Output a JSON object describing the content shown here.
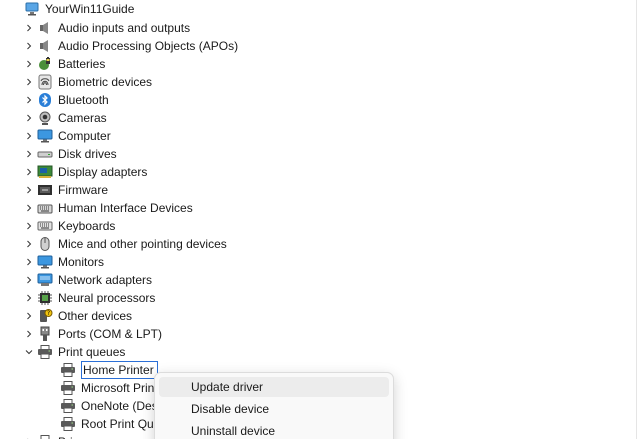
{
  "root_node": {
    "label": "YourWin11Guide",
    "icon": "computer-icon"
  },
  "categories": [
    {
      "label": "Audio inputs and outputs",
      "icon": "speaker-icon"
    },
    {
      "label": "Audio Processing Objects (APOs)",
      "icon": "speaker-icon"
    },
    {
      "label": "Batteries",
      "icon": "battery-icon"
    },
    {
      "label": "Biometric devices",
      "icon": "fingerprint-icon"
    },
    {
      "label": "Bluetooth",
      "icon": "bluetooth-icon"
    },
    {
      "label": "Cameras",
      "icon": "camera-icon"
    },
    {
      "label": "Computer",
      "icon": "monitor-icon"
    },
    {
      "label": "Disk drives",
      "icon": "disk-drive-icon"
    },
    {
      "label": "Display adapters",
      "icon": "display-adapter-icon"
    },
    {
      "label": "Firmware",
      "icon": "firmware-icon"
    },
    {
      "label": "Human Interface Devices",
      "icon": "hid-icon"
    },
    {
      "label": "Keyboards",
      "icon": "keyboard-icon"
    },
    {
      "label": "Mice and other pointing devices",
      "icon": "mouse-icon"
    },
    {
      "label": "Monitors",
      "icon": "monitor-icon"
    },
    {
      "label": "Network adapters",
      "icon": "network-adapter-icon"
    },
    {
      "label": "Neural processors",
      "icon": "chip-icon"
    },
    {
      "label": "Other devices",
      "icon": "unknown-device-icon"
    },
    {
      "label": "Ports (COM & LPT)",
      "icon": "port-icon"
    },
    {
      "label": "Print queues",
      "icon": "printer-icon",
      "expanded": true
    }
  ],
  "print_queue_children": [
    {
      "label": "Home Printer",
      "icon": "printer-icon",
      "selected": true
    },
    {
      "label": "Microsoft Prin",
      "icon": "printer-icon"
    },
    {
      "label": "OneNote (Des",
      "icon": "printer-icon"
    },
    {
      "label": "Root Print Qu",
      "icon": "printer-icon"
    }
  ],
  "partial_next_category": {
    "label": "Pri",
    "icon": "printer-icon"
  },
  "context_menu": {
    "items": [
      {
        "label": "Update driver",
        "hovered": true
      },
      {
        "label": "Disable device"
      },
      {
        "label": "Uninstall device"
      }
    ]
  },
  "colors": {
    "selection_border": "#2b6fd6",
    "menu_hover": "#ececec",
    "menu_background": "#f9f9f9"
  }
}
